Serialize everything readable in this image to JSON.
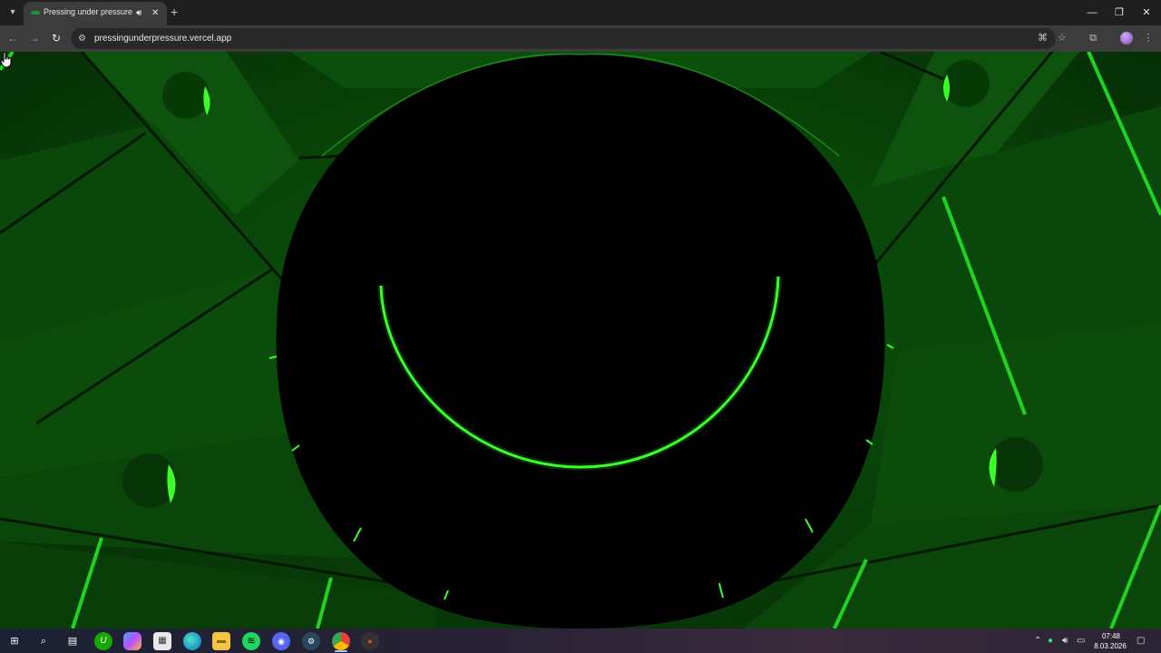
{
  "browser": {
    "tab_title": "Pressing under pressure",
    "url": "pressingunderpressure.vercel.app"
  },
  "icons": {
    "tab_search": "chevron-down-icon",
    "favicon": "green-favicon-icon",
    "tab_audio": "speaker-icon",
    "tab_close": "close-icon",
    "new_tab": "plus-icon",
    "minimize": "minimize-icon",
    "maximize": "restore-icon",
    "close_window": "close-icon",
    "back": "arrow-left-icon",
    "forward": "arrow-right-icon",
    "reload": "reload-icon",
    "site_info": "tune-icon",
    "translate": "translate-icon",
    "bookmark": "star-icon",
    "extensions": "puzzle-icon",
    "menu": "kebab-icon"
  },
  "game": {
    "scene": "green-lit-mechanical-press-seen-from-below",
    "accent_color": "#39ff2a",
    "plate_color": "#000000",
    "background_color": "#0b4a0b"
  },
  "taskbar": {
    "apps": [
      "start",
      "search",
      "task-view",
      "upwork",
      "copilot",
      "store",
      "edge",
      "file-explorer",
      "spotify",
      "discord",
      "steam",
      "chrome",
      "record"
    ],
    "active_app": "chrome",
    "clock_time": "07:48",
    "clock_date": "8.03.2026"
  }
}
